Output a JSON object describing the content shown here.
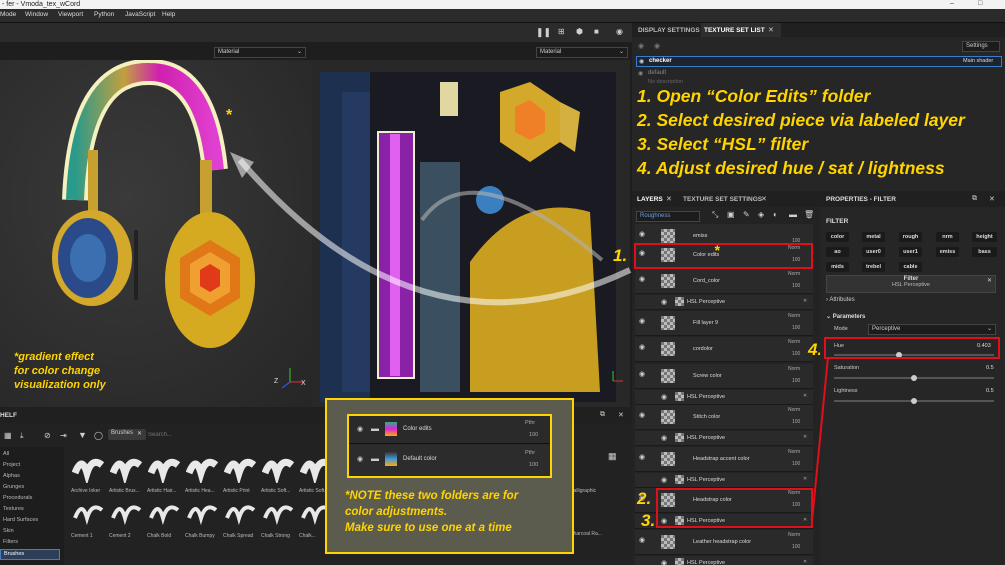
{
  "window": {
    "title": "- fer - Vmoda_tex_wCord",
    "controls": [
      "–",
      "□"
    ]
  },
  "menu": [
    "Mode",
    "Window",
    "Viewport",
    "Python",
    "JavaScript",
    "Help"
  ],
  "viewport": {
    "material_left": "Material",
    "material_right": "Material",
    "axis_labels": [
      "Z",
      "X"
    ]
  },
  "tabs_right": {
    "display_settings": "DISPLAY SETTINGS",
    "texture_set_list": "TEXTURE SET LIST",
    "settings": "Settings"
  },
  "texture_sets": {
    "checker": "checker",
    "main_shader": "Main shader",
    "default": "default",
    "no_description": "No description"
  },
  "instructions": [
    "1. Open “Color Edits” folder",
    "2. Select desired piece via labeled layer",
    "3. Select “HSL” filter",
    "4. Adjust desired hue / sat / lightness"
  ],
  "layers_panel": {
    "tab_layers": "LAYERS",
    "tab_tss": "TEXTURE SET SETTINGS",
    "channel": "Roughness",
    "rows": [
      {
        "name": "emiss",
        "blend": "",
        "opacity": "100"
      },
      {
        "name": "Color edits",
        "blend": "Norm",
        "opacity": "100"
      },
      {
        "name": "Cord_color",
        "blend": "Norm",
        "opacity": "100"
      },
      {
        "name": "HSL Perceptive",
        "blend": "",
        "opacity": ""
      },
      {
        "name": "Fill layer 9",
        "blend": "Norm",
        "opacity": "100"
      },
      {
        "name": "cordolor",
        "blend": "Norm",
        "opacity": "100"
      },
      {
        "name": "Screw color",
        "blend": "Norm",
        "opacity": "100"
      },
      {
        "name": "HSL Perceptive",
        "blend": "",
        "opacity": ""
      },
      {
        "name": "Stitch color",
        "blend": "Norm",
        "opacity": "100"
      },
      {
        "name": "HSL Perceptive",
        "blend": "",
        "opacity": ""
      },
      {
        "name": "Headstrap accent color",
        "blend": "Norm",
        "opacity": "100"
      },
      {
        "name": "HSL Perceptive",
        "blend": "",
        "opacity": ""
      },
      {
        "name": "Headstrap color",
        "blend": "Norm",
        "opacity": "100"
      },
      {
        "name": "HSL Perceptive",
        "blend": "",
        "opacity": ""
      },
      {
        "name": "Leather headstrap color",
        "blend": "Norm",
        "opacity": "100"
      },
      {
        "name": "HSL Perceptive",
        "blend": "",
        "opacity": ""
      }
    ],
    "step_labels": [
      "1.",
      "2.",
      "3.",
      "4."
    ]
  },
  "properties": {
    "title": "PROPERTIES - FILTER",
    "section": "FILTER",
    "chips": [
      "color",
      "metal",
      "rough",
      "nrm",
      "height",
      "ao",
      "user0",
      "user1",
      "emiss",
      "bass",
      "mids",
      "trebel",
      "cable"
    ],
    "filter_label": "Filter",
    "filter_name": "HSL Perceptive",
    "attributes": "Attributes",
    "parameters": "Parameters",
    "mode_label": "Mode",
    "mode_value": "Perceptive",
    "hue": {
      "label": "Hue",
      "value": "0.403"
    },
    "saturation": {
      "label": "Saturation",
      "value": "0.5"
    },
    "lightness": {
      "label": "Lightness",
      "value": "0.5"
    }
  },
  "gradient_note": [
    "*gradient effect",
    "for color change",
    "visualization only"
  ],
  "note_box": {
    "folders": [
      {
        "name": "Color edits",
        "blend": "Pthr",
        "opacity": "100"
      },
      {
        "name": "Default color",
        "blend": "Pthr",
        "opacity": "100"
      }
    ],
    "lines": [
      "*NOTE these two folders are for",
      "color adjustments.",
      "Make sure to use one at a time"
    ]
  },
  "shelf": {
    "title": "HELF",
    "tab": "Brushes",
    "search_placeholder": "Search...",
    "categories": [
      "All",
      "Project",
      "Alphas",
      "Grunges",
      "Procedurals",
      "Textures",
      "Hard Surfaces",
      "Skin",
      "Filters",
      "Brushes"
    ],
    "brushes_row1": [
      "Archive Inker",
      "Artistic Brus...",
      "Artistic Hair...",
      "Artistic Hea...",
      "Artistic Print",
      "Artistic Soft...",
      "Artistic Soft..."
    ],
    "brushes_row2": [
      "Cement 1",
      "Cement 2",
      "Chalk Bold",
      "Chalk Bumpy",
      "Chalk Spread",
      "Chalk Strong",
      "Chalk..."
    ],
    "right_labels": [
      "Calligraphic",
      "Charcoal Ra..."
    ]
  },
  "colors": {
    "accent": "#ffd400",
    "highlight": "#e0101a",
    "panel": "#262626"
  }
}
